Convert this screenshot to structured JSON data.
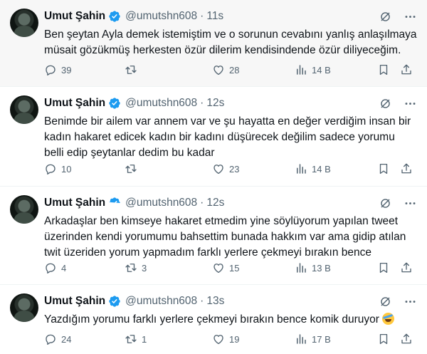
{
  "tweets": [
    {
      "author": "Umut Şahin",
      "handle": "@umutshn608",
      "separator": "·",
      "time": "11s",
      "text": "Ben şeytan Ayla demek istemiştim ve o sorunun cevabını yanlış anlaşılmaya müsait gözükmüş herkesten özür dilerim kendisindende özür diliyeceğim.",
      "replies": "39",
      "retweets": "",
      "likes": "28",
      "views": "14 B"
    },
    {
      "author": "Umut Şahin",
      "handle": "@umutshn608",
      "separator": "·",
      "time": "12s",
      "text": "Benimde bir ailem var annem var ve şu hayatta en değer verdiğim insan bir kadın hakaret edicek kadın bir kadını düşürecek değilim sadece yorumu belli edip şeytanlar dedim bu kadar",
      "replies": "10",
      "retweets": "",
      "likes": "23",
      "views": "14 B"
    },
    {
      "author": "Umut Şahin",
      "handle": "@umutshn608",
      "separator": "·",
      "time": "12s",
      "text": "Arkadaşlar ben kimseye hakaret etmedim yine söylüyorum yapılan tweet üzerinden kendi yorumumu bahsettim bunada hakkım var ama gidip atılan twit üzeriden yorum yapmadım farklı yerlere çekmeyi bırakın bence",
      "replies": "4",
      "retweets": "3",
      "likes": "15",
      "views": "13 B"
    },
    {
      "author": "Umut Şahin",
      "handle": "@umutshn608",
      "separator": "·",
      "time": "13s",
      "text": "Yazdığım yorumu farklı yerlere çekmeyi bırakın bence komik duruyor",
      "replies": "24",
      "retweets": "1",
      "likes": "19",
      "views": "17 B"
    }
  ],
  "icons": {
    "verified": "verified-badge-icon",
    "grok": "grok-icon",
    "more": "more-icon",
    "reply": "reply-icon",
    "retweet": "retweet-icon",
    "like": "heart-icon",
    "views": "views-icon",
    "bookmark": "bookmark-icon",
    "share": "share-icon",
    "emoji": "rolling-laughing-emoji"
  },
  "colors": {
    "verified": "#1d9bf0",
    "text": "#0f1419",
    "muted": "#536471",
    "highlight_bg": "#f7f7f7"
  }
}
